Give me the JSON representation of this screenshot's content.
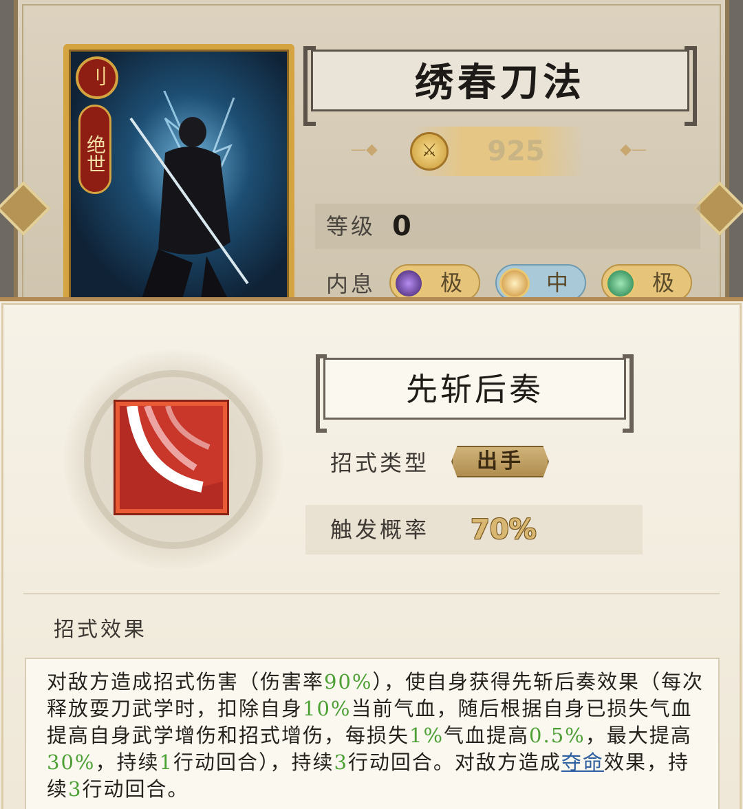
{
  "weapon": {
    "name": "绣春刀法",
    "power": "925",
    "rank": "绝世",
    "level_label": "等级",
    "level_value": "0",
    "neixi_label": "内息",
    "neixi": [
      {
        "grade": "极",
        "icon": "purple-moon-icon"
      },
      {
        "grade": "中",
        "icon": "golden-sun-icon"
      },
      {
        "grade": "极",
        "icon": "green-ring-icon"
      }
    ]
  },
  "skill": {
    "name": "先斩后奏",
    "type_label": "招式类型",
    "type_value": "出手",
    "trigger_label": "触发概率",
    "trigger_value": "70%",
    "effect_label": "招式效果",
    "effect": {
      "p1": "对敌方造成招式伤害（伤害率",
      "n1": "90%",
      "p2": "），使自身获得先斩后奏效果（每次释放耍刀武学时，扣除自身",
      "n2": "10%",
      "p3": "当前气血，随后根据自身已损失气血提高自身武学增伤和招式增伤，每损失",
      "n3": "1%",
      "p4": "气血提高",
      "n4": "0.5%",
      "p5": "，最大提高",
      "n5": "30%",
      "p6": "，持续",
      "n6": "1",
      "p7": "行动回合），持续",
      "n7": "3",
      "p8": "行动回合。对敌方造成",
      "link": "夺命",
      "p9": "效果，持续",
      "n8": "3",
      "p10": "行动回合。"
    }
  },
  "colors": {
    "number": "#4da035",
    "link": "#2c5ea0",
    "gold": "#d4a441"
  }
}
